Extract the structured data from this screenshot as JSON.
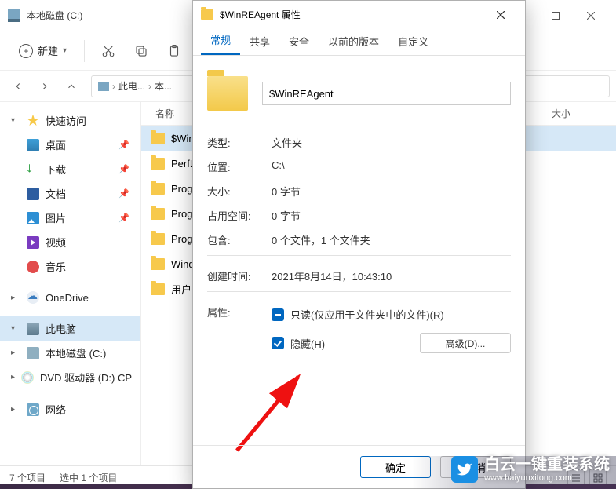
{
  "explorer": {
    "title": "本地磁盘 (C:)",
    "toolbar": {
      "new_label": "新建"
    },
    "breadcrumb": {
      "seg1": "此电...",
      "seg2": "本..."
    },
    "columns": {
      "name": "名称",
      "size": "大小"
    },
    "sidebar": {
      "quick": "快速访问",
      "desktop": "桌面",
      "downloads": "下载",
      "documents": "文档",
      "pictures": "图片",
      "videos": "视频",
      "music": "音乐",
      "onedrive": "OneDrive",
      "thispc": "此电脑",
      "drive_c": "本地磁盘 (C:)",
      "dvd": "DVD 驱动器 (D:) CP",
      "network": "网络"
    },
    "rows": [
      {
        "name": "$WinREA..."
      },
      {
        "name": "PerfLogs"
      },
      {
        "name": "Program..."
      },
      {
        "name": "Program..."
      },
      {
        "name": "Program..."
      },
      {
        "name": "Windows..."
      },
      {
        "name": "用户"
      }
    ],
    "status": {
      "items": "7 个项目",
      "selected": "选中 1 个项目"
    }
  },
  "dialog": {
    "title": "$WinREAgent 属性",
    "tabs": {
      "general": "常规",
      "sharing": "共享",
      "security": "安全",
      "previous": "以前的版本",
      "custom": "自定义"
    },
    "name_value": "$WinREAgent",
    "rows": {
      "type_l": "类型:",
      "type_v": "文件夹",
      "loc_l": "位置:",
      "loc_v": "C:\\",
      "size_l": "大小:",
      "size_v": "0 字节",
      "disk_l": "占用空间:",
      "disk_v": "0 字节",
      "cont_l": "包含:",
      "cont_v": "0 个文件，1 个文件夹",
      "ctime_l": "创建时间:",
      "ctime_v": "2021年8月14日，10:43:10",
      "attr_l": "属性:"
    },
    "attrs": {
      "readonly": "只读(仅应用于文件夹中的文件)(R)",
      "hidden": "隐藏(H)",
      "advanced": "高级(D)..."
    },
    "buttons": {
      "ok": "确定",
      "cancel": "取消"
    }
  },
  "watermark": {
    "brand": "白云一键重装系统",
    "url": "www.baiyunxitong.com"
  }
}
